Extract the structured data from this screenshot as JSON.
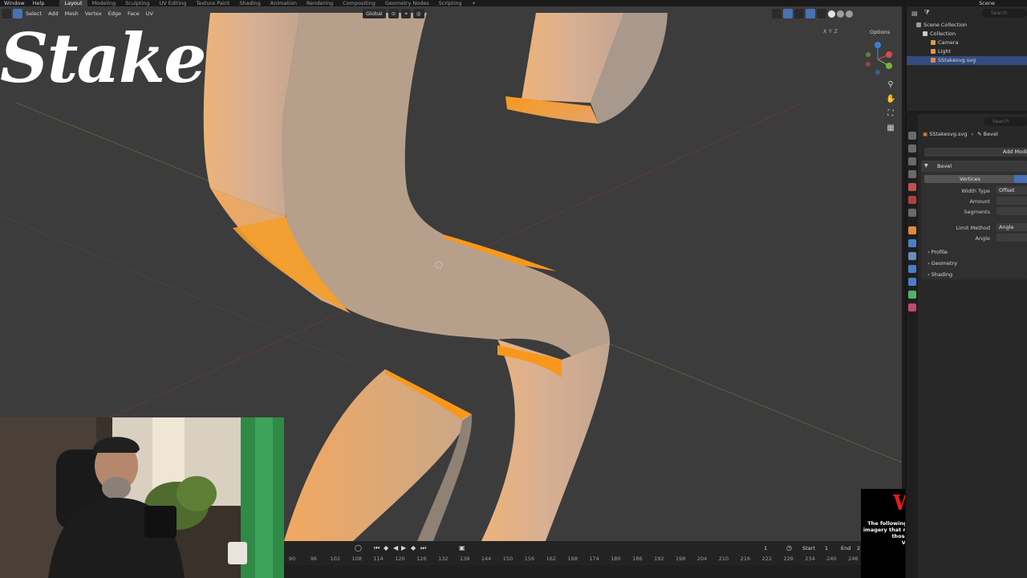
{
  "menu": [
    "Window",
    "Help"
  ],
  "workspaces": [
    "Layout",
    "Modeling",
    "Sculpting",
    "UV Editing",
    "Texture Paint",
    "Shading",
    "Animation",
    "Rendering",
    "Compositing",
    "Geometry Nodes",
    "Scripting",
    "+"
  ],
  "scene_name": "Scene",
  "viewport_menu": [
    "Select",
    "Add",
    "Mesh",
    "Vertex",
    "Edge",
    "Face",
    "UV"
  ],
  "transform_orientation": "Global",
  "options_label": "Options",
  "axis_toggles": [
    "X",
    "Y",
    "Z"
  ],
  "logo_text": "Stake",
  "gizmo_axes": [
    "X",
    "Y",
    "Z"
  ],
  "outliner": {
    "search_placeholder": "Search",
    "items": [
      {
        "label": "Scene Collection",
        "icon": "collection-icon"
      },
      {
        "label": "Collection",
        "icon": "collection-icon"
      },
      {
        "label": "Camera",
        "icon": "camera-icon"
      },
      {
        "label": "Light",
        "icon": "light-icon"
      },
      {
        "label": "SStakesvg.svg",
        "icon": "mesh-icon",
        "selected": true
      }
    ]
  },
  "properties": {
    "search_placeholder": "Search",
    "breadcrumb": {
      "object": "SStakesvg.svg",
      "modifier": "Bevel"
    },
    "add_modifier": "Add Modi",
    "modifier_name": "Bevel",
    "affect_mode": "Vertices",
    "fields": [
      {
        "label": "Width Type",
        "value": "Offset"
      },
      {
        "label": "Amount",
        "value": ""
      },
      {
        "label": "Segments",
        "value": ""
      },
      {
        "label": "Limit Method",
        "value": "Angle"
      },
      {
        "label": "Angle",
        "value": ""
      }
    ],
    "subpanels": [
      "Profile",
      "Geometry",
      "Shading"
    ]
  },
  "timeline": {
    "current_frame": "1",
    "start_label": "Start",
    "start_value": "1",
    "end_label": "End",
    "end_value": "2",
    "ticks": [
      "90",
      "96",
      "102",
      "108",
      "114",
      "120",
      "126",
      "132",
      "138",
      "144",
      "150",
      "156",
      "162",
      "168",
      "174",
      "180",
      "186",
      "192",
      "198",
      "204",
      "210",
      "216",
      "222",
      "228",
      "234",
      "240",
      "246"
    ]
  },
  "warning": {
    "title": "Warning!",
    "body_lines": [
      "The following contains bright, flashing lights and/or",
      "imagery that may cause discomfort and/or seizures for",
      "those with photosensitive epilepsy.",
      "Viewer discretion is advised."
    ]
  },
  "colors": {
    "viewport_bg": "#3c3c3c",
    "mesh_face": "#b7a08b",
    "mesh_selected": "#f7981c",
    "accent": "#4772b3",
    "warning_red": "#e31d1d"
  }
}
